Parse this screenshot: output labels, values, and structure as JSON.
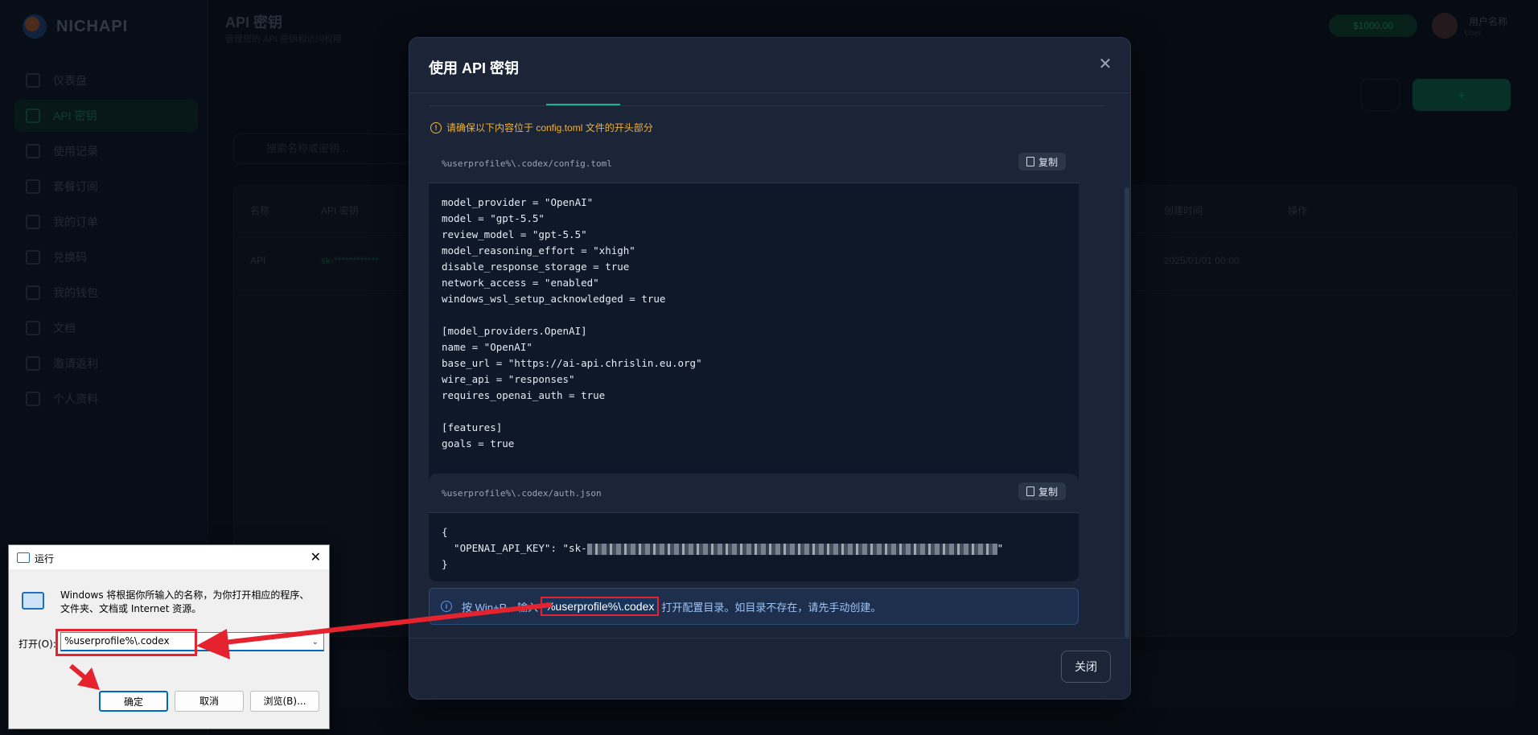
{
  "background": {
    "brand": "NICHAPI",
    "page_title": "API 密钥",
    "page_subtitle": "管理您的 API 密钥和访问权限",
    "nav": [
      "仪表盘",
      "API 密钥",
      "使用记录",
      "套餐订阅",
      "我的订单",
      "兑换码",
      "我的钱包",
      "文档",
      "邀请返利",
      "个人资料"
    ],
    "search_placeholder": "搜索名称或密钥...",
    "table_headers": [
      "名称",
      "API 密钥",
      "创建时间",
      "操作"
    ],
    "row": {
      "name": "API",
      "key": "sk-************",
      "created": "2025/01/01 00:00"
    },
    "user_name": "用户名称",
    "user_role": "User",
    "balance": "$1000.00"
  },
  "modal": {
    "title": "使用 API 密钥",
    "warning": "请确保以下内容位于 config.toml 文件的开头部分",
    "copy_label": "复制",
    "config_path": "%userprofile%\\.codex/config.toml",
    "config_lines": [
      "model_provider = \"OpenAI\"",
      "model = \"gpt-5.5\"",
      "review_model = \"gpt-5.5\"",
      "model_reasoning_effort = \"xhigh\"",
      "disable_response_storage = true",
      "network_access = \"enabled\"",
      "windows_wsl_setup_acknowledged = true",
      "",
      "[model_providers.OpenAI]",
      "name = \"OpenAI\"",
      "base_url = \"https://ai-api.chrislin.eu.org\"",
      "wire_api = \"responses\"",
      "requires_openai_auth = true",
      "",
      "[features]",
      "goals = true"
    ],
    "auth_path": "%userprofile%\\.codex/auth.json",
    "auth_open": "{",
    "auth_key_prefix": "  \"OPENAI_API_KEY\": \"sk-",
    "auth_key_suffix": "\"",
    "auth_close": "}",
    "info_before": "按 Win+R，输入",
    "info_highlight": "%userprofile%\\.codex",
    "info_after": "打开配置目录。如目录不存在，请先手动创建。",
    "close_label": "关闭"
  },
  "run_dialog": {
    "title": "运行",
    "description": "Windows 将根据你所输入的名称，为你打开相应的程序、文件夹、文档或 Internet 资源。",
    "open_label": "打开(O):",
    "input_value": "%userprofile%\\.codex",
    "ok": "确定",
    "cancel": "取消",
    "browse": "浏览(B)..."
  },
  "colors": {
    "accent": "#19b58a",
    "warning": "#f0b232",
    "annotation_red": "#e5232f",
    "info_blue": "#5a96e6"
  }
}
